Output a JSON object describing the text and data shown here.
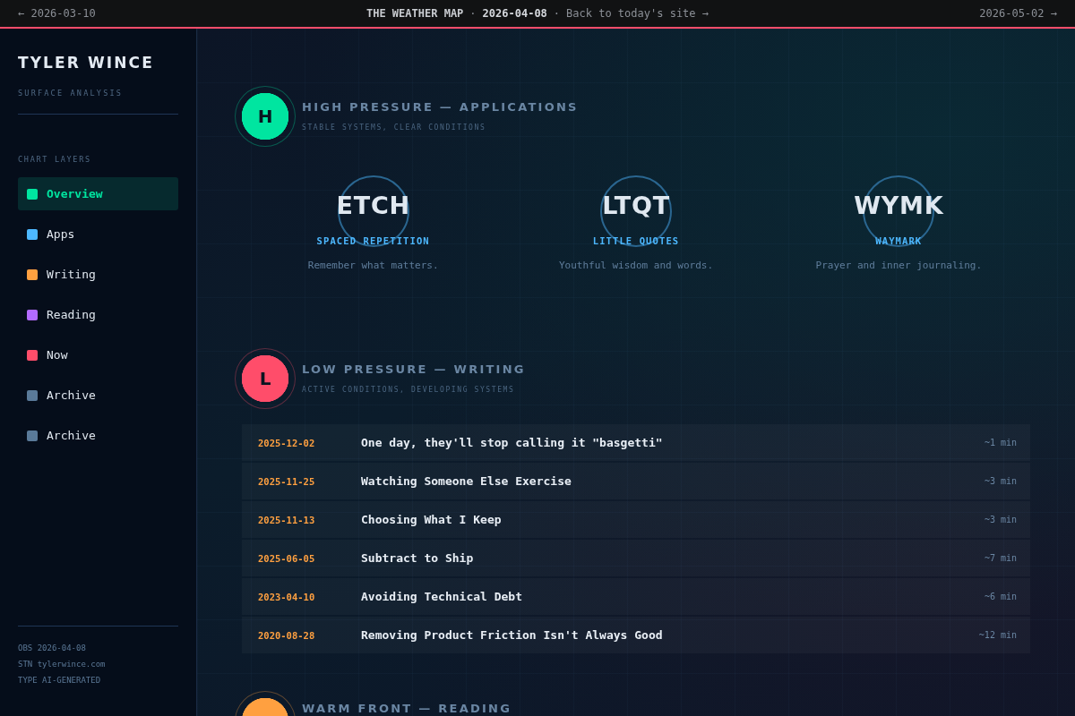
{
  "top_bar": {
    "prev_link": "← 2026-03-10",
    "center": [
      {
        "kind": "title",
        "text": "THE WEATHER MAP"
      },
      {
        "kind": "separator",
        "text": "·"
      },
      {
        "kind": "date",
        "text": "2026-04-08"
      },
      {
        "kind": "separator",
        "text": "·"
      },
      {
        "kind": "link",
        "text": "Back to today's site →"
      }
    ],
    "next_link": "2026-05-02 →"
  },
  "sidebar": {
    "title": "TYLER WINCE",
    "subtitle": "SURFACE ANALYSIS",
    "section_label": "CHART LAYERS",
    "items": [
      {
        "label": "Overview",
        "color": "#00e5a0",
        "selected": true
      },
      {
        "label": "Apps",
        "color": "#4db8ff",
        "selected": false
      },
      {
        "label": "Writing",
        "color": "#ffa040",
        "selected": false
      },
      {
        "label": "Reading",
        "color": "#b36bff",
        "selected": false
      },
      {
        "label": "Now",
        "color": "#ff4d6a",
        "selected": false
      },
      {
        "label": "Archive",
        "color": "#5a7a99",
        "selected": false
      },
      {
        "label": "Archive",
        "color": "#5a7a99",
        "selected": false
      }
    ],
    "footer": [
      "OBS 2026-04-08",
      "STN tylerwince.com",
      "TYPE AI-GENERATED"
    ]
  },
  "sections": [
    {
      "kind": "apps",
      "badge": "H",
      "color": "#00e5a0",
      "title": "HIGH PRESSURE — APPLICATIONS",
      "subtitle": "STABLE SYSTEMS, CLEAR CONDITIONS",
      "apps": [
        {
          "name": "ETCH",
          "tagline": "SPACED REPETITION",
          "description": "Remember what matters."
        },
        {
          "name": "LTQT",
          "tagline": "LITTLE QUOTES",
          "description": "Youthful wisdom and words."
        },
        {
          "name": "WYMK",
          "tagline": "WAYMARK",
          "description": "Prayer and inner journaling."
        }
      ]
    },
    {
      "kind": "posts",
      "badge": "L",
      "color": "#ff4d6a",
      "title": "LOW PRESSURE — WRITING",
      "subtitle": "ACTIVE CONDITIONS, DEVELOPING SYSTEMS",
      "posts": [
        {
          "date": "2025-12-02",
          "title": "One day, they'll stop calling it \"basgetti\"",
          "read_time": "~1 min"
        },
        {
          "date": "2025-11-25",
          "title": "Watching Someone Else Exercise",
          "read_time": "~3 min"
        },
        {
          "date": "2025-11-13",
          "title": "Choosing What I Keep",
          "read_time": "~3 min"
        },
        {
          "date": "2025-06-05",
          "title": "Subtract to Ship",
          "read_time": "~7 min"
        },
        {
          "date": "2023-04-10",
          "title": "Avoiding Technical Debt",
          "read_time": "~6 min"
        },
        {
          "date": "2020-08-28",
          "title": "Removing Product Friction Isn't Always Good",
          "read_time": "~12 min"
        }
      ]
    },
    {
      "kind": "teaser",
      "color": "#ffa040",
      "title": "WARM FRONT — READING"
    }
  ]
}
